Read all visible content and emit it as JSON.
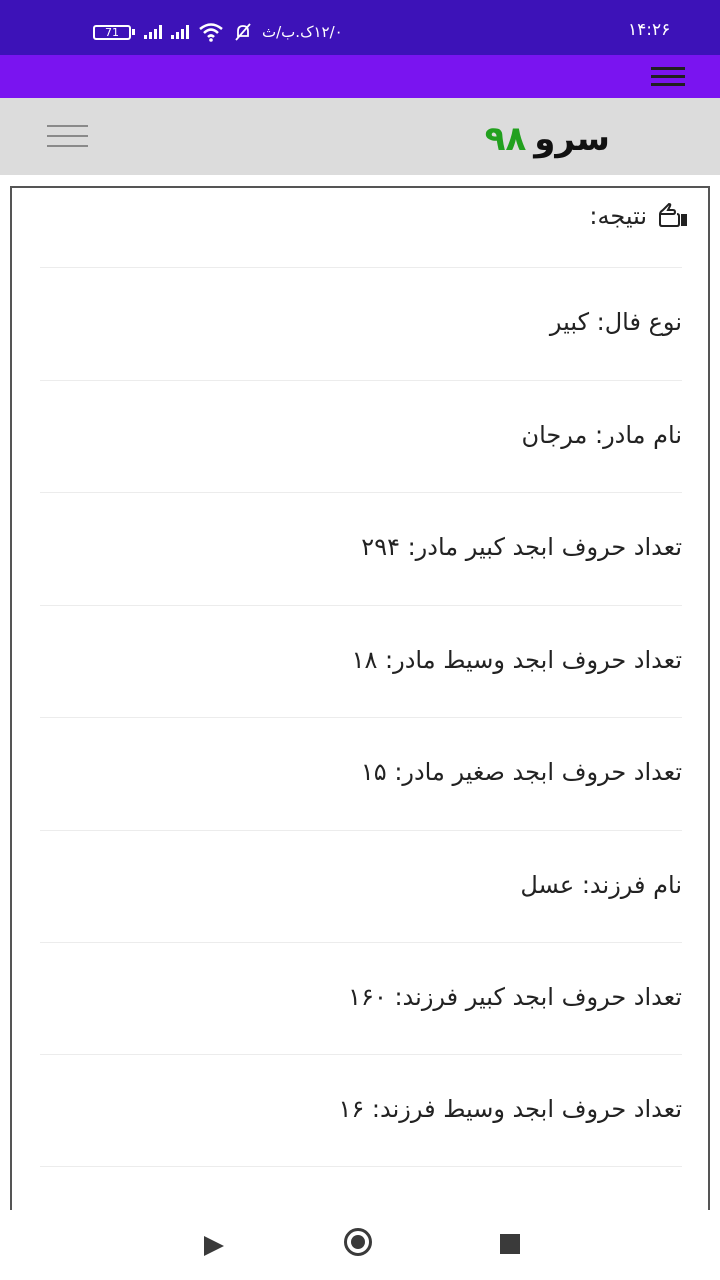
{
  "status_bar": {
    "time": "۱۴:۲۶",
    "data_speed": "۱۲/۰ک.ب/ث",
    "battery": "71",
    "icons": [
      "battery-icon",
      "signal-icon",
      "signal-icon",
      "wifi-icon",
      "muted-bell-icon"
    ]
  },
  "app_bar": {
    "menu_icon": "hamburger-icon"
  },
  "header": {
    "logo_word": "سرو",
    "logo_number": "۹۸",
    "menu_icon": "hamburger-icon",
    "colors": {
      "logo_number": "#22a01e",
      "status_bar": "#3d12b8",
      "app_bar": "#7a14f0"
    }
  },
  "result": {
    "title": "نتیجه:",
    "icon": "hand-pointing-icon",
    "rows": [
      "نوع فال: کبیر",
      "نام مادر: مرجان",
      "تعداد حروف ابجد کبیر مادر: ۲۹۴",
      "تعداد حروف ابجد وسیط مادر: ۱۸",
      "تعداد حروف ابجد صغیر مادر: ۱۵",
      "نام فرزند: عسل",
      "تعداد حروف ابجد کبیر فرزند: ۱۶۰",
      "تعداد حروف ابجد وسیط فرزند: ۱۶"
    ]
  },
  "nav_bar": {
    "icons": [
      "back-triangle-icon",
      "home-circle-icon",
      "recents-square-icon"
    ]
  }
}
